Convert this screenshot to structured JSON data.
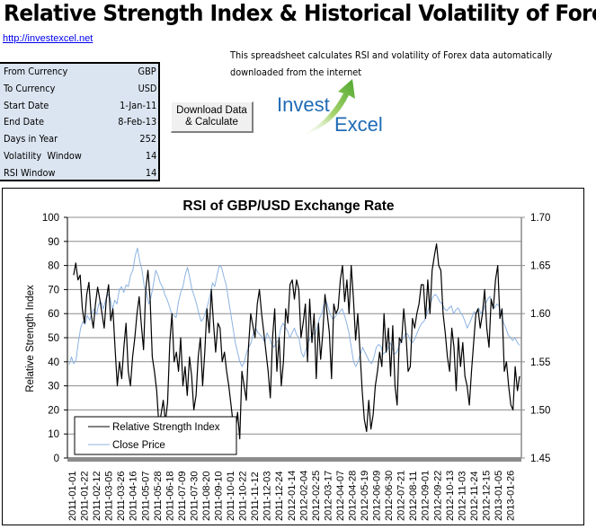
{
  "header": {
    "title": "Relative Strength Index & Historical Volatility of Forex",
    "link": "http://investexcel.net",
    "description": "This spreadsheet calculates RSI and volatility of Forex data automatically downloaded from the internet"
  },
  "params": [
    {
      "label": "From Currency",
      "value": "GBP"
    },
    {
      "label": "To Currency",
      "value": "USD"
    },
    {
      "label": "Start Date",
      "value": "1-Jan-11"
    },
    {
      "label": "End Date",
      "value": "8-Feb-13"
    },
    {
      "label": "Days in Year",
      "value": "252"
    },
    {
      "label": "Volatility  Window",
      "value": "14"
    },
    {
      "label": "RSI Window",
      "value": "14"
    }
  ],
  "button": {
    "label_line1": "Download Data",
    "label_line2": "& Calculate"
  },
  "logo": {
    "word1": "Invest",
    "word2": "Excel",
    "icon": "green-arrow-icon"
  },
  "colors": {
    "rsi": "#000000",
    "price": "#8db3e2",
    "params_bg": "#dbe5f1",
    "logo_text": "#1f6bb5",
    "logo_arrow": "#7ac143"
  },
  "chart_data": {
    "type": "line",
    "title": "RSI of GBP/USD Exchange Rate",
    "ylabel": "Relative Strength Index",
    "y2label": "",
    "xlabel": "",
    "ylim": [
      0,
      100
    ],
    "y2lim": [
      1.45,
      1.7
    ],
    "yticks": [
      "0",
      "10",
      "20",
      "30",
      "40",
      "50",
      "60",
      "70",
      "80",
      "90",
      "100"
    ],
    "y2ticks": [
      "1.45",
      "1.50",
      "1.55",
      "1.60",
      "1.65",
      "1.70"
    ],
    "grid": true,
    "legend": "bottom-left",
    "xticks": [
      "2011-01-01",
      "2011-01-22",
      "2011-02-12",
      "2011-03-05",
      "2011-03-26",
      "2011-04-16",
      "2011-05-07",
      "2011-05-28",
      "2011-06-18",
      "2011-07-09",
      "2011-07-30",
      "2011-08-20",
      "2011-09-10",
      "2011-10-01",
      "2011-10-22",
      "2011-11-12",
      "2011-12-03",
      "2011-12-24",
      "2012-01-14",
      "2012-02-04",
      "2012-02-25",
      "2012-03-17",
      "2012-04-07",
      "2012-04-28",
      "2012-05-19",
      "2012-06-09",
      "2012-06-30",
      "2012-07-21",
      "2012-08-11",
      "2012-09-01",
      "2012-09-22",
      "2012-10-13",
      "2012-11-03",
      "2012-11-24",
      "2012-12-15",
      "2013-01-05",
      "2013-01-26"
    ],
    "series": [
      {
        "name": "Relative Strength Index",
        "axis": "left",
        "start_index": 2,
        "values": [
          76,
          81,
          74,
          76,
          62,
          56,
          68,
          73,
          60,
          54,
          64,
          71,
          66,
          60,
          54,
          66,
          72,
          57,
          62,
          45,
          30,
          40,
          33,
          46,
          56,
          36,
          30,
          42,
          50,
          60,
          67,
          55,
          45,
          70,
          78,
          66,
          42,
          36,
          28,
          14,
          18,
          24,
          15,
          23,
          48,
          60,
          40,
          44,
          36,
          50,
          30,
          38,
          26,
          42,
          34,
          20,
          26,
          42,
          50,
          30,
          44,
          62,
          52,
          70,
          56,
          44,
          56,
          54,
          40,
          44,
          36,
          30,
          22,
          14,
          10,
          19,
          8,
          36,
          30,
          24,
          46,
          60,
          55,
          50,
          64,
          70,
          60,
          52,
          44,
          36,
          25,
          50,
          62,
          36,
          50,
          30,
          40,
          62,
          56,
          72,
          74,
          66,
          74,
          70,
          50,
          56,
          64,
          40,
          66,
          48,
          60,
          33,
          56,
          41,
          52,
          68,
          60,
          52,
          33,
          64,
          60,
          62,
          74,
          80,
          65,
          74,
          60,
          80,
          66,
          49,
          60,
          44,
          28,
          16,
          11,
          24,
          12,
          18,
          30,
          36,
          44,
          38,
          60,
          44,
          54,
          34,
          55,
          30,
          22,
          50,
          48,
          62,
          52,
          36,
          38,
          58,
          54,
          60,
          64,
          72,
          72,
          58,
          74,
          60,
          78,
          84,
          89,
          80,
          78,
          60,
          52,
          42,
          36,
          54,
          46,
          28,
          50,
          38,
          48,
          34,
          30,
          22,
          36,
          48,
          60,
          62,
          54,
          60,
          70,
          54,
          46,
          66,
          62,
          74,
          80,
          58,
          62,
          36,
          40,
          30,
          22,
          20,
          38,
          28,
          34
        ]
      },
      {
        "name": "Close Price",
        "axis": "right",
        "start_index": 0,
        "values": [
          1.547,
          1.555,
          1.548,
          1.552,
          1.57,
          1.585,
          1.592,
          1.589,
          1.598,
          1.593,
          1.601,
          1.605,
          1.599,
          1.61,
          1.612,
          1.605,
          1.614,
          1.62,
          1.616,
          1.604,
          1.614,
          1.61,
          1.625,
          1.628,
          1.622,
          1.63,
          1.628,
          1.64,
          1.645,
          1.66,
          1.668,
          1.655,
          1.645,
          1.628,
          1.622,
          1.61,
          1.618,
          1.63,
          1.645,
          1.64,
          1.632,
          1.628,
          1.62,
          1.615,
          1.608,
          1.6,
          1.598,
          1.596,
          1.612,
          1.622,
          1.628,
          1.64,
          1.648,
          1.637,
          1.625,
          1.618,
          1.61,
          1.6,
          1.592,
          1.595,
          1.602,
          1.61,
          1.62,
          1.632,
          1.628,
          1.64,
          1.65,
          1.648,
          1.638,
          1.63,
          1.615,
          1.6,
          1.585,
          1.57,
          1.56,
          1.55,
          1.545,
          1.55,
          1.56,
          1.565,
          1.57,
          1.58,
          1.585,
          1.58,
          1.578,
          1.575,
          1.57,
          1.58,
          1.575,
          1.568,
          1.565,
          1.57,
          1.572,
          1.585,
          1.59,
          1.586,
          1.582,
          1.575,
          1.58,
          1.585,
          1.578,
          1.575,
          1.56,
          1.555,
          1.562,
          1.57,
          1.575,
          1.58,
          1.578,
          1.585,
          1.595,
          1.6,
          1.61,
          1.613,
          1.605,
          1.598,
          1.594,
          1.597,
          1.6,
          1.602,
          1.605,
          1.598,
          1.59,
          1.58,
          1.565,
          1.55,
          1.545,
          1.55,
          1.558,
          1.565,
          1.56,
          1.555,
          1.55,
          1.548,
          1.555,
          1.565,
          1.568,
          1.566,
          1.558,
          1.56,
          1.563,
          1.57,
          1.565,
          1.558,
          1.56,
          1.566,
          1.572,
          1.575,
          1.58,
          1.578,
          1.572,
          1.57,
          1.574,
          1.58,
          1.586,
          1.59,
          1.592,
          1.598,
          1.605,
          1.612,
          1.618,
          1.62,
          1.617,
          1.612,
          1.61,
          1.605,
          1.603,
          1.606,
          1.608,
          1.6,
          1.604,
          1.606,
          1.601,
          1.598,
          1.592,
          1.585,
          1.59,
          1.596,
          1.602,
          1.6,
          1.606,
          1.6,
          1.603,
          1.61,
          1.615,
          1.618,
          1.608,
          1.606,
          1.61,
          1.608,
          1.6,
          1.59,
          1.585,
          1.578,
          1.575,
          1.572,
          1.575,
          1.57,
          1.567
        ]
      }
    ]
  }
}
